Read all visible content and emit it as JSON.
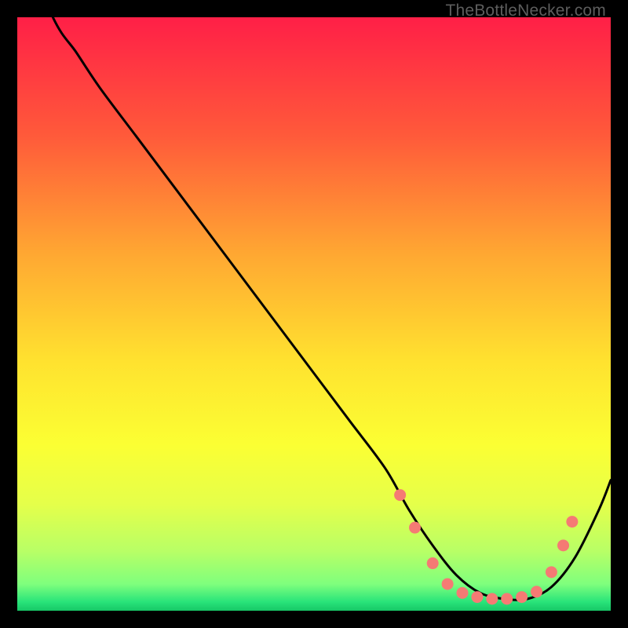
{
  "watermark": "TheBottleNecker.com",
  "chart_data": {
    "type": "line",
    "title": "",
    "xlabel": "",
    "ylabel": "",
    "xlim": [
      0,
      100
    ],
    "ylim": [
      0,
      100
    ],
    "gradient_stops": [
      {
        "pos": 0.0,
        "color": "#ff1f47"
      },
      {
        "pos": 0.2,
        "color": "#ff5a3a"
      },
      {
        "pos": 0.4,
        "color": "#ffa832"
      },
      {
        "pos": 0.58,
        "color": "#ffe22f"
      },
      {
        "pos": 0.72,
        "color": "#fbff33"
      },
      {
        "pos": 0.82,
        "color": "#e5ff4a"
      },
      {
        "pos": 0.9,
        "color": "#b8ff66"
      },
      {
        "pos": 0.955,
        "color": "#7fff7d"
      },
      {
        "pos": 0.985,
        "color": "#29e47a"
      },
      {
        "pos": 1.0,
        "color": "#17c766"
      }
    ],
    "series": [
      {
        "name": "bottleneck-curve",
        "x": [
          0,
          6,
          10,
          14,
          20,
          26,
          32,
          38,
          44,
          50,
          56,
          62,
          66,
          70,
          74,
          78,
          82,
          86,
          90,
          94,
          98,
          100
        ],
        "y": [
          115,
          100,
          94,
          88,
          80,
          72,
          64,
          56,
          48,
          40,
          32,
          24,
          17,
          11,
          6,
          3,
          2,
          2,
          4,
          9,
          17,
          22
        ]
      }
    ],
    "markers": {
      "name": "highlight-dots",
      "color": "#f57a74",
      "radius": 7.5,
      "points": [
        {
          "x": 64.5,
          "y": 19.5
        },
        {
          "x": 67.0,
          "y": 14.0
        },
        {
          "x": 70.0,
          "y": 8.0
        },
        {
          "x": 72.5,
          "y": 4.5
        },
        {
          "x": 75.0,
          "y": 3.0
        },
        {
          "x": 77.5,
          "y": 2.3
        },
        {
          "x": 80.0,
          "y": 2.0
        },
        {
          "x": 82.5,
          "y": 2.0
        },
        {
          "x": 85.0,
          "y": 2.3
        },
        {
          "x": 87.5,
          "y": 3.2
        },
        {
          "x": 90.0,
          "y": 6.5
        },
        {
          "x": 92.0,
          "y": 11.0
        },
        {
          "x": 93.5,
          "y": 15.0
        }
      ]
    }
  }
}
